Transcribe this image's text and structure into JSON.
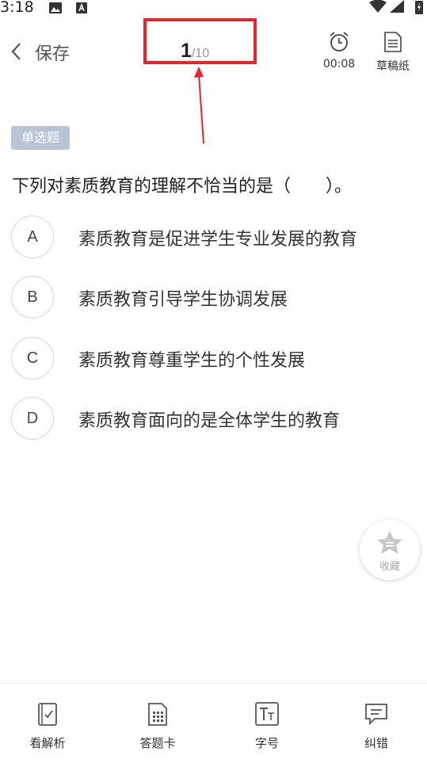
{
  "status_bar": {
    "time": "3:18"
  },
  "header": {
    "back_label": "保存",
    "counter_current": "1",
    "counter_total": "/10",
    "timer_value": "00:08",
    "draft_label": "草稿纸"
  },
  "question": {
    "type_tag": "单选题",
    "text": "下列对素质教育的理解不恰当的是（　　）。",
    "options": [
      {
        "letter": "A",
        "text": "素质教育是促进学生专业发展的教育"
      },
      {
        "letter": "B",
        "text": "素质教育引导学生协调发展"
      },
      {
        "letter": "C",
        "text": "素质教育尊重学生的个性发展"
      },
      {
        "letter": "D",
        "text": "素质教育面向的是全体学生的教育"
      }
    ]
  },
  "favorite": {
    "label": "收藏"
  },
  "bottom_tabs": [
    {
      "label": "看解析",
      "icon": "analysis-icon"
    },
    {
      "label": "答题卡",
      "icon": "answer-card-icon"
    },
    {
      "label": "字号",
      "icon": "font-size-icon"
    },
    {
      "label": "纠错",
      "icon": "feedback-icon"
    }
  ],
  "colors": {
    "highlight": "#e8232b",
    "tag_bg": "#b9c4d6"
  }
}
